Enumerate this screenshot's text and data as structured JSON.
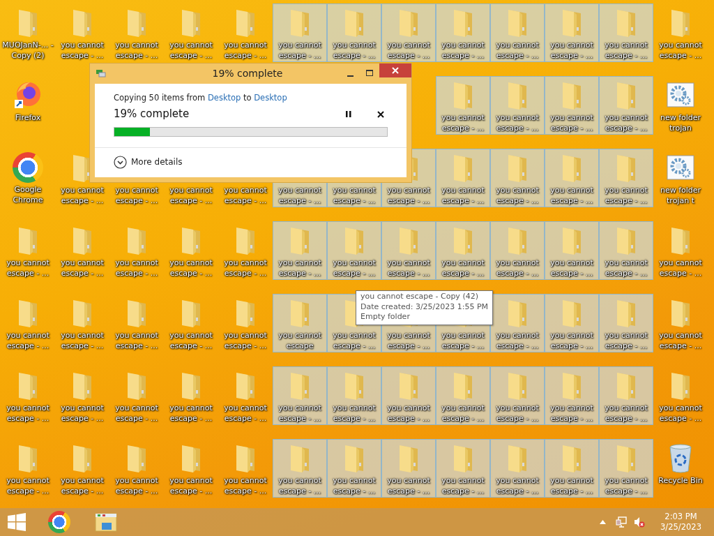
{
  "desktop": {
    "rows": [
      [
        {
          "label": "MUOJanN-... - Copy (2)",
          "kind": "folder",
          "selected": false
        },
        {
          "label": "you cannot escape - ...",
          "kind": "folder",
          "selected": false
        },
        {
          "label": "you cannot escape - ...",
          "kind": "folder",
          "selected": false
        },
        {
          "label": "you cannot escape - ...",
          "kind": "folder",
          "selected": false
        },
        {
          "label": "you cannot escape - ...",
          "kind": "folder",
          "selected": false
        },
        {
          "label": "you cannot escape - ...",
          "kind": "folder",
          "selected": true
        },
        {
          "label": "you cannot escape - ...",
          "kind": "folder",
          "selected": true
        },
        {
          "label": "you cannot escape - ...",
          "kind": "folder",
          "selected": true
        },
        {
          "label": "you cannot escape - ...",
          "kind": "folder",
          "selected": true
        },
        {
          "label": "you cannot escape - ...",
          "kind": "folder",
          "selected": true
        },
        {
          "label": "you cannot escape - ...",
          "kind": "folder",
          "selected": true
        },
        {
          "label": "you cannot escape - ...",
          "kind": "folder",
          "selected": true
        },
        {
          "label": "you cannot escape - ...",
          "kind": "folder",
          "selected": false
        }
      ],
      [
        {
          "label": "Firefox",
          "kind": "firefox",
          "selected": false
        },
        null,
        null,
        null,
        null,
        null,
        null,
        null,
        {
          "label": "you cannot escape - ...",
          "kind": "folder",
          "selected": true
        },
        {
          "label": "you cannot escape - ...",
          "kind": "folder",
          "selected": true
        },
        {
          "label": "you cannot escape - ...",
          "kind": "folder",
          "selected": true
        },
        {
          "label": "you cannot escape - ...",
          "kind": "folder",
          "selected": true
        },
        {
          "label": "new folder trojan",
          "kind": "program",
          "selected": false
        }
      ],
      [
        {
          "label": "Google Chrome",
          "kind": "chrome",
          "selected": false
        },
        {
          "label": "you cannot escape - ...",
          "kind": "folder",
          "selected": false
        },
        {
          "label": "you cannot escape - ...",
          "kind": "folder",
          "selected": false
        },
        {
          "label": "you cannot escape - ...",
          "kind": "folder",
          "selected": false
        },
        {
          "label": "you cannot escape - ...",
          "kind": "folder",
          "selected": false
        },
        {
          "label": "you cannot escape - ...",
          "kind": "folder",
          "selected": true
        },
        {
          "label": "you cannot escape - ...",
          "kind": "folder",
          "selected": true
        },
        {
          "label": "you cannot escape - ...",
          "kind": "folder",
          "selected": true
        },
        {
          "label": "you cannot escape - ...",
          "kind": "folder",
          "selected": true
        },
        {
          "label": "you cannot escape - ...",
          "kind": "folder",
          "selected": true
        },
        {
          "label": "you cannot escape - ...",
          "kind": "folder",
          "selected": true
        },
        {
          "label": "you cannot escape - ...",
          "kind": "folder",
          "selected": true
        },
        {
          "label": "new folder trojan t",
          "kind": "program",
          "selected": false
        }
      ],
      [
        {
          "label": "you cannot escape - ...",
          "kind": "folder",
          "selected": false
        },
        {
          "label": "you cannot escape - ...",
          "kind": "folder",
          "selected": false
        },
        {
          "label": "you cannot escape - ...",
          "kind": "folder",
          "selected": false
        },
        {
          "label": "you cannot escape - ...",
          "kind": "folder",
          "selected": false
        },
        {
          "label": "you cannot escape - ...",
          "kind": "folder",
          "selected": false
        },
        {
          "label": "you cannot escape - ...",
          "kind": "folder",
          "selected": true
        },
        {
          "label": "you cannot escape - ...",
          "kind": "folder",
          "selected": true
        },
        {
          "label": "you cannot escape - ...",
          "kind": "folder",
          "selected": true
        },
        {
          "label": "you cannot escape - ...",
          "kind": "folder",
          "selected": true
        },
        {
          "label": "you cannot escape - ...",
          "kind": "folder",
          "selected": true
        },
        {
          "label": "you cannot escape - ...",
          "kind": "folder",
          "selected": true
        },
        {
          "label": "you cannot escape - ...",
          "kind": "folder",
          "selected": true
        },
        {
          "label": "you cannot escape - ...",
          "kind": "folder",
          "selected": false
        }
      ],
      [
        {
          "label": "you cannot escape - ...",
          "kind": "folder",
          "selected": false
        },
        {
          "label": "you cannot escape - ...",
          "kind": "folder",
          "selected": false
        },
        {
          "label": "you cannot escape - ...",
          "kind": "folder",
          "selected": false
        },
        {
          "label": "you cannot escape - ...",
          "kind": "folder",
          "selected": false
        },
        {
          "label": "you cannot escape - ...",
          "kind": "folder",
          "selected": false
        },
        {
          "label": "you cannot escape",
          "kind": "folder",
          "selected": true
        },
        {
          "label": "you cannot escape - ...",
          "kind": "folder",
          "selected": true
        },
        {
          "label": "you cannot escape - ...",
          "kind": "folder",
          "selected": true
        },
        {
          "label": "you cannot escape - ...",
          "kind": "folder",
          "selected": true
        },
        {
          "label": "you cannot escape - ...",
          "kind": "folder",
          "selected": true
        },
        {
          "label": "you cannot escape - ...",
          "kind": "folder",
          "selected": true
        },
        {
          "label": "you cannot escape - ...",
          "kind": "folder",
          "selected": true
        },
        {
          "label": "you cannot escape - ...",
          "kind": "folder",
          "selected": false
        }
      ],
      [
        {
          "label": "you cannot escape - ...",
          "kind": "folder",
          "selected": false
        },
        {
          "label": "you cannot escape - ...",
          "kind": "folder",
          "selected": false
        },
        {
          "label": "you cannot escape - ...",
          "kind": "folder",
          "selected": false
        },
        {
          "label": "you cannot escape - ...",
          "kind": "folder",
          "selected": false
        },
        {
          "label": "you cannot escape - ...",
          "kind": "folder",
          "selected": false
        },
        {
          "label": "you cannot escape - ...",
          "kind": "folder",
          "selected": true
        },
        {
          "label": "you cannot escape - ...",
          "kind": "folder",
          "selected": true
        },
        {
          "label": "you cannot escape - ...",
          "kind": "folder",
          "selected": true
        },
        {
          "label": "you cannot escape - ...",
          "kind": "folder",
          "selected": true
        },
        {
          "label": "you cannot escape - ...",
          "kind": "folder",
          "selected": true
        },
        {
          "label": "you cannot escape - ...",
          "kind": "folder",
          "selected": true
        },
        {
          "label": "you cannot escape - ...",
          "kind": "folder",
          "selected": true
        },
        {
          "label": "you cannot escape - ...",
          "kind": "folder",
          "selected": false
        }
      ],
      [
        {
          "label": "you cannot escape - ...",
          "kind": "folder",
          "selected": false
        },
        {
          "label": "you cannot escape - ...",
          "kind": "folder",
          "selected": false
        },
        {
          "label": "you cannot escape - ...",
          "kind": "folder",
          "selected": false
        },
        {
          "label": "you cannot escape - ...",
          "kind": "folder",
          "selected": false
        },
        {
          "label": "you cannot escape - ...",
          "kind": "folder",
          "selected": false
        },
        {
          "label": "you cannot escape - ...",
          "kind": "folder",
          "selected": true
        },
        {
          "label": "you cannot escape - ...",
          "kind": "folder",
          "selected": true
        },
        {
          "label": "you cannot escape - ...",
          "kind": "folder",
          "selected": true
        },
        {
          "label": "you cannot escape - ...",
          "kind": "folder",
          "selected": true
        },
        {
          "label": "you cannot escape - ...",
          "kind": "folder",
          "selected": true
        },
        {
          "label": "you cannot escape - ...",
          "kind": "folder",
          "selected": true
        },
        {
          "label": "you cannot escape - ...",
          "kind": "folder",
          "selected": true
        },
        {
          "label": "Recycle Bin",
          "kind": "recycle-bin",
          "selected": false
        }
      ]
    ]
  },
  "dialog": {
    "title": "19% complete",
    "copy_text": {
      "prefix": "Copying 50 items from",
      "source": "Desktop",
      "middle": "to",
      "destination": "Desktop"
    },
    "progress_title": "19% complete",
    "level": 0.13,
    "more_details": "More details"
  },
  "tooltip": {
    "lines": [
      "you cannot escape - Copy (42)",
      "Date created: 3/25/2023 1:55 PM",
      "Empty folder"
    ]
  },
  "taskbar": {
    "apps": [
      {
        "kind": "start"
      },
      {
        "kind": "chrome"
      },
      {
        "kind": "explorer"
      }
    ],
    "time": "2:03 PM",
    "date": "3/25/2023"
  }
}
